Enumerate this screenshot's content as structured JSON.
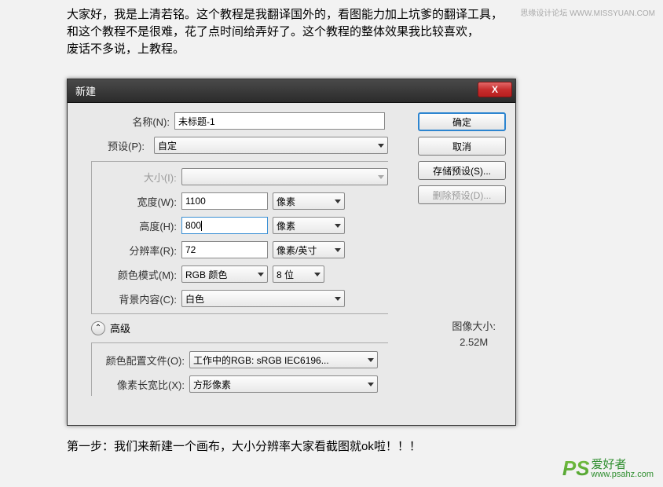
{
  "watermark_top": "思缘设计论坛   WWW.MISSYUAN.COM",
  "intro_line1": "大家好，我是上清若铭。这个教程是我翻译国外的，看图能力加上坑爹的翻译工具，",
  "intro_line2": "和这个教程不是很难，花了点时间给弄好了。这个教程的整体效果我比较喜欢，",
  "intro_line3": "废话不多说，上教程。",
  "dialog": {
    "title": "新建",
    "close": "X",
    "labels": {
      "name": "名称(N):",
      "preset": "预设(P):",
      "size": "大小(I):",
      "width": "宽度(W):",
      "height": "高度(H):",
      "resolution": "分辨率(R):",
      "color_mode": "颜色模式(M):",
      "background": "背景内容(C):",
      "advanced": "高级",
      "color_profile": "颜色配置文件(O):",
      "pixel_ratio": "像素长宽比(X):"
    },
    "values": {
      "name": "未标题-1",
      "preset": "自定",
      "size": "",
      "width": "1100",
      "height": "800",
      "resolution": "72",
      "color_mode": "RGB 颜色",
      "bit_depth": "8 位",
      "background": "白色",
      "color_profile": "工作中的RGB: sRGB IEC6196...",
      "pixel_ratio": "方形像素"
    },
    "units": {
      "width": "像素",
      "height": "像素",
      "resolution": "像素/英寸"
    },
    "buttons": {
      "ok": "确定",
      "cancel": "取消",
      "save_preset": "存储预设(S)...",
      "delete_preset": "删除预设(D)..."
    },
    "image_size_label": "图像大小:",
    "image_size_value": "2.52M"
  },
  "step_text": "第一步：我们来新建一个画布，大小分辨率大家看截图就ok啦！！！",
  "watermark_bottom": {
    "logo": "PS",
    "cn": "爱好者",
    "url": "www.psahz.com"
  }
}
